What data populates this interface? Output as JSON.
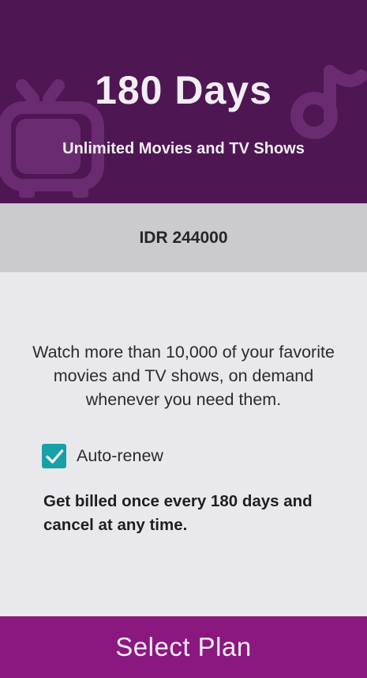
{
  "plan": {
    "title": "180 Days",
    "subtitle": "Unlimited Movies and TV Shows",
    "price": "IDR 244000",
    "description": "Watch more than 10,000 of your favorite movies and TV shows, on demand whenever you need them.",
    "auto_renew": {
      "label": "Auto-renew",
      "checked": true
    },
    "billing_note": "Get billed once every 180 days and cancel at any time."
  },
  "actions": {
    "select_plan_label": "Select Plan"
  },
  "icons": {
    "header_left": "tv-icon",
    "header_right": "music-note-icon",
    "checkbox": "checkmark-icon"
  },
  "colors": {
    "header_bg": "#4e1652",
    "price_band_bg": "#cbcacd",
    "body_bg": "#e9e8eb",
    "checkbox": "#17a0a6",
    "button_bg": "#8b187f"
  }
}
